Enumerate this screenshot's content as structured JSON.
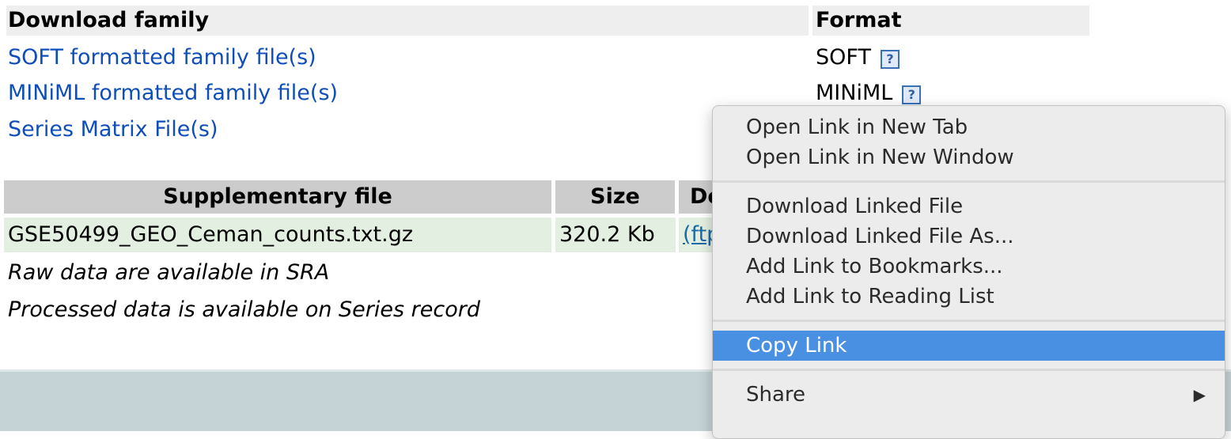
{
  "download_family": {
    "header": "Download family",
    "format_header": "Format",
    "rows": [
      {
        "link": "SOFT formatted family file(s)",
        "format": "SOFT"
      },
      {
        "link": "MINiML formatted family file(s)",
        "format": "MINiML"
      },
      {
        "link": "Series Matrix File(s)",
        "format": ""
      }
    ],
    "help_icon": "?"
  },
  "supplementary": {
    "headers": {
      "file": "Supplementary file",
      "size": "Size",
      "download": "Do"
    },
    "row": {
      "file": "GSE50499_GEO_Ceman_counts.txt.gz",
      "size": "320.2 Kb",
      "download": "(ftp"
    },
    "notes": [
      "Raw data are available in SRA",
      "Processed data is available on Series record"
    ]
  },
  "context_menu": {
    "items": [
      {
        "label": "Open Link in New Tab"
      },
      {
        "label": "Open Link in New Window"
      },
      {
        "label": "Download Linked File"
      },
      {
        "label": "Download Linked File As..."
      },
      {
        "label": "Add Link to Bookmarks..."
      },
      {
        "label": "Add Link to Reading List"
      },
      {
        "label": "Copy Link",
        "selected": true
      },
      {
        "label": "Share",
        "submenu": true
      }
    ],
    "submenu_arrow": "▶",
    "selection_color": "#4a90e2"
  }
}
